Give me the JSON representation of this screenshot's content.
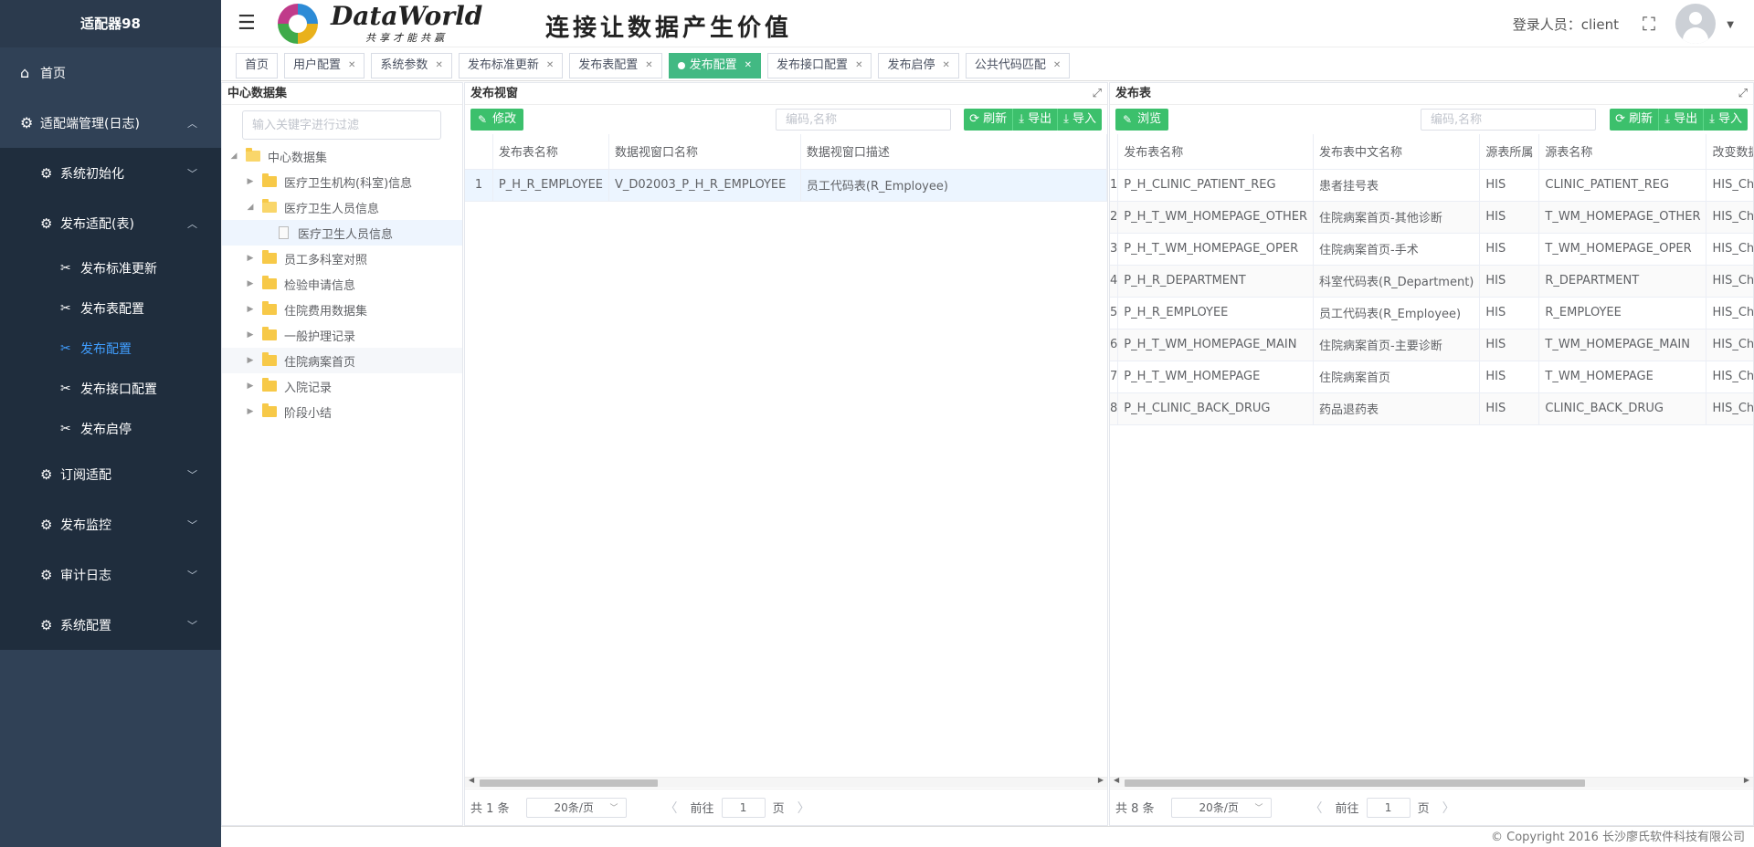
{
  "sidebar": {
    "brand": "适配器98",
    "home": "首页",
    "adapter_mgmt": "适配端管理(日志)",
    "sub": {
      "sys_init": "系统初始化",
      "publish_adapt": "发布适配(表)",
      "leaves": [
        "发布标准更新",
        "发布表配置",
        "发布配置",
        "发布接口配置",
        "发布启停"
      ]
    },
    "subscribe": "订阅适配",
    "monitor": "发布监控",
    "audit": "审计日志",
    "sysconfig": "系统配置"
  },
  "header": {
    "logo_title": "DataWorld",
    "logo_sub": "共享才能共赢",
    "slogan": "连接让数据产生价值",
    "user_label": "登录人员：client"
  },
  "tags": [
    {
      "label": "首页",
      "closable": false,
      "active": false
    },
    {
      "label": "用户配置",
      "closable": true,
      "active": false
    },
    {
      "label": "系统参数",
      "closable": true,
      "active": false
    },
    {
      "label": "发布标准更新",
      "closable": true,
      "active": false
    },
    {
      "label": "发布表配置",
      "closable": true,
      "active": false
    },
    {
      "label": "发布配置",
      "closable": true,
      "active": true
    },
    {
      "label": "发布接口配置",
      "closable": true,
      "active": false
    },
    {
      "label": "发布启停",
      "closable": true,
      "active": false
    },
    {
      "label": "公共代码匹配",
      "closable": true,
      "active": false
    }
  ],
  "tree_panel": {
    "title": "中心数据集",
    "filter_placeholder": "输入关键字进行过滤",
    "root": "中心数据集",
    "nodes": [
      "医疗卫生机构(科室)信息",
      "医疗卫生人员信息",
      "员工多科室对照",
      "检验申请信息",
      "住院费用数据集",
      "一般护理记录",
      "住院病案首页",
      "入院记录",
      "阶段小结"
    ],
    "child": "医疗卫生人员信息"
  },
  "mid_panel": {
    "title": "发布视窗",
    "edit_btn": "修改",
    "search_placeholder": "编码,名称",
    "refresh": "刷新",
    "export": "导出",
    "import": "导入",
    "columns": [
      "发布表名称",
      "数据视窗口名称",
      "数据视窗口描述"
    ],
    "rows": [
      [
        "1",
        "P_H_R_EMPLOYEE",
        "V_D02003_P_H_R_EMPLOYEE",
        "员工代码表(R_Employee)"
      ]
    ],
    "total": "共 1 条",
    "page_size": "20条/页",
    "goto": "前往",
    "page": "1",
    "page_unit": "页"
  },
  "right_panel": {
    "title": "发布表",
    "browse_btn": "浏览",
    "search_placeholder": "编码,名称",
    "refresh": "刷新",
    "export": "导出",
    "import": "导入",
    "columns": [
      "发布表名称",
      "发布表中文名称",
      "源表所属",
      "源表名称",
      "改变数据集"
    ],
    "rows": [
      [
        "1",
        "P_H_CLINIC_PATIENT_REG",
        "患者挂号表",
        "HIS",
        "CLINIC_PATIENT_REG",
        "HIS_Change"
      ],
      [
        "2",
        "P_H_T_WM_HOMEPAGE_OTHER",
        "住院病案首页-其他诊断",
        "HIS",
        "T_WM_HOMEPAGE_OTHER",
        "HIS_Change"
      ],
      [
        "3",
        "P_H_T_WM_HOMEPAGE_OPER",
        "住院病案首页-手术",
        "HIS",
        "T_WM_HOMEPAGE_OPER",
        "HIS_Change"
      ],
      [
        "4",
        "P_H_R_DEPARTMENT",
        "科室代码表(R_Department)",
        "HIS",
        "R_DEPARTMENT",
        "HIS_Change"
      ],
      [
        "5",
        "P_H_R_EMPLOYEE",
        "员工代码表(R_Employee)",
        "HIS",
        "R_EMPLOYEE",
        "HIS_Change"
      ],
      [
        "6",
        "P_H_T_WM_HOMEPAGE_MAIN",
        "住院病案首页-主要诊断",
        "HIS",
        "T_WM_HOMEPAGE_MAIN",
        "HIS_Change"
      ],
      [
        "7",
        "P_H_T_WM_HOMEPAGE",
        "住院病案首页",
        "HIS",
        "T_WM_HOMEPAGE",
        "HIS_Change"
      ],
      [
        "8",
        "P_H_CLINIC_BACK_DRUG",
        "药品退药表",
        "HIS",
        "CLINIC_BACK_DRUG",
        "HIS_Change"
      ]
    ],
    "total": "共 8 条",
    "page_size": "20条/页",
    "goto": "前往",
    "page": "1",
    "page_unit": "页"
  },
  "footer": "© Copyright 2016 长沙廖氏软件科技有限公司",
  "colors": {
    "sidebar": "#304156",
    "accent_green": "#3cc06c",
    "active_tag": "#42b983",
    "active_menu": "#409eff"
  }
}
